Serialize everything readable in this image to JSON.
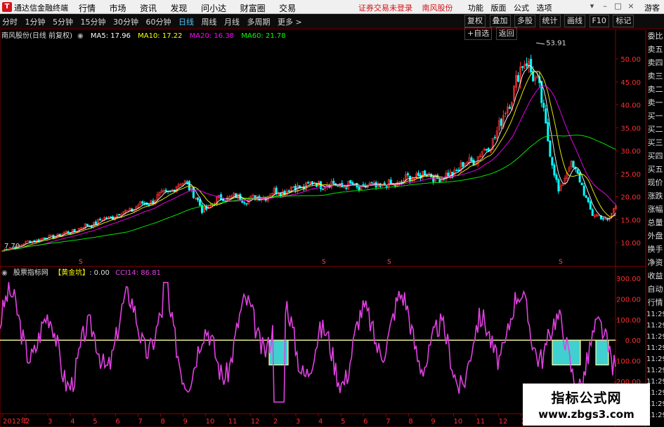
{
  "titlebar": {
    "app_name": "通达信金融终端",
    "menu": [
      "行情",
      "市场",
      "资讯",
      "发现",
      "问小达",
      "财富圈",
      "交易"
    ],
    "status_left": "证券交易未登录",
    "status_stock": "南风股份",
    "right_menu": [
      "功能",
      "版面",
      "公式",
      "选项"
    ],
    "guest": "游客"
  },
  "toolbar": {
    "periods": [
      "分时",
      "1分钟",
      "5分钟",
      "15分钟",
      "30分钟",
      "60分钟",
      "日线",
      "周线",
      "月线",
      "多周期",
      "更多 >"
    ],
    "active_period": "日线",
    "tools": [
      "复权",
      "叠加",
      "多股",
      "统计",
      "画线",
      "F10",
      "标记",
      "+自选",
      "返回"
    ]
  },
  "main_chart": {
    "stock_label": "南风股份(日线 前复权)",
    "ma5": "MA5: 17.96",
    "ma10": "MA10: 17.22",
    "ma20": "MA20: 16.38",
    "ma60": "MA60: 21.78",
    "high_label": "53.91",
    "low_label": "7.70",
    "y_ticks": [
      "50.00",
      "45.00",
      "40.00",
      "35.00",
      "30.00",
      "25.00",
      "20.00",
      "15.00",
      "10.00"
    ],
    "markers": [
      "S",
      "S",
      "S",
      "S"
    ],
    "colors": {
      "ma5": "#ffffff",
      "ma10": "#ffff00",
      "ma20": "#ff00ff",
      "ma60": "#00ff00",
      "up": "#ff3030",
      "down": "#00ffff"
    }
  },
  "indicator": {
    "name": "股票指标网",
    "formula": "【黄金坑】",
    "value": ": 0.00",
    "cci": "CCI14: 86.81",
    "y_ticks": [
      "300.00",
      "200.00",
      "100.00",
      "0.00",
      "-100.00",
      "-200.00"
    ],
    "colors": {
      "cci": "#e040e0",
      "zero_line": "#ffffa0",
      "pit": "#40d0d0"
    }
  },
  "x_axis": {
    "labels": [
      "2012年",
      "2",
      "3",
      "4",
      "5",
      "6",
      "7",
      "8",
      "9",
      "10",
      "11",
      "12",
      "2",
      "3",
      "4",
      "5",
      "6",
      "7",
      "8",
      "9",
      "10",
      "11",
      "12",
      "2",
      "3",
      "4",
      "5",
      "6"
    ]
  },
  "quote_column": {
    "items": [
      "委比",
      "卖五",
      "卖四",
      "卖三",
      "卖二",
      "卖一",
      "买一",
      "买二",
      "买三",
      "买四",
      "买五",
      "现价",
      "涨跌",
      "涨幅",
      "总量",
      "外盘",
      "换手",
      "净资",
      "收益",
      "自动",
      "行情"
    ],
    "times": [
      "11:29",
      "11:29",
      "11:29",
      "11:29",
      "11:29",
      "11:29",
      "11:29",
      "11:29",
      "11:29",
      "11:29"
    ]
  },
  "watermark": {
    "line1": "指标公式网",
    "line2": "www.zbgs3.com"
  }
}
